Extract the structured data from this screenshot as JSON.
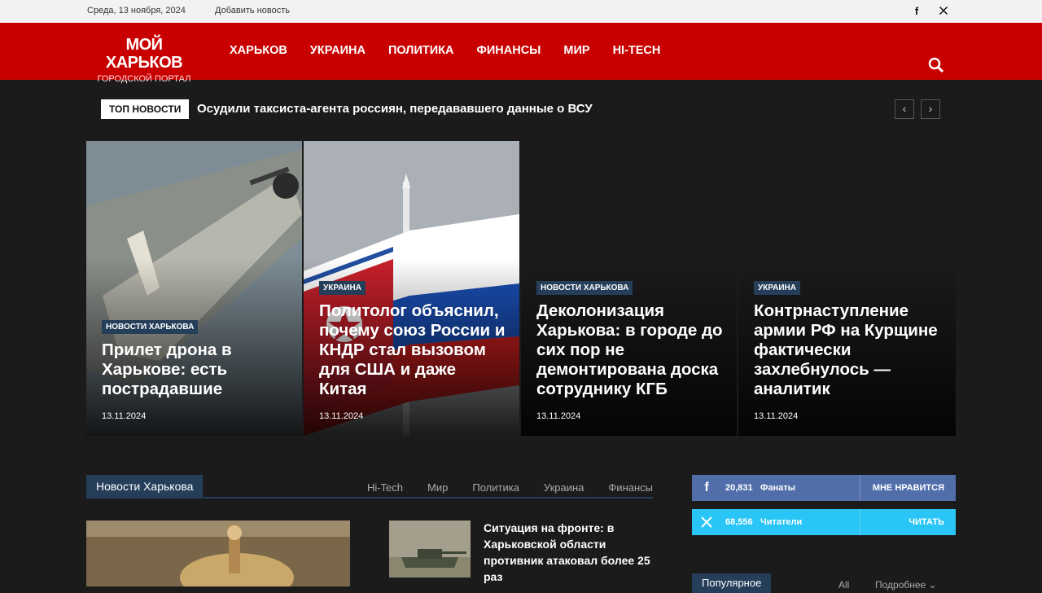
{
  "topbar": {
    "date": "Среда, 13 ноября, 2024",
    "add_news": "Добавить новость",
    "social_icons": [
      "facebook-icon",
      "x-icon"
    ]
  },
  "header": {
    "logo_line1": "МОЙ ХАРЬКОВ",
    "logo_line2": "ГОРОДСКОЙ ПОРТАЛ",
    "nav": [
      "ХАРЬКОВ",
      "УКРАИНА",
      "ПОЛИТИКА",
      "ФИНАНСЫ",
      "МИР",
      "HI-TECH"
    ],
    "accent_color": "#c90000"
  },
  "ticker": {
    "tag": "ТОП НОВОСТИ",
    "headline": "Осудили таксиста-агента россиян, передававшего данные о ВСУ"
  },
  "featured": [
    {
      "category": "НОВОСТИ ХАРЬКОВА",
      "title": "Прилет дрона в Харькове: есть пострадавшие",
      "date": "13.11.2024"
    },
    {
      "category": "УКРАИНА",
      "title": "Политолог объяснил, почему союз России и КНДР стал вызовом для США и даже Китая",
      "date": "13.11.2024"
    },
    {
      "category": "НОВОСТИ ХАРЬКОВА",
      "title": "Деколонизация Харькова: в городе до сих пор не демонтирована доска сотруднику КГБ",
      "date": "13.11.2024"
    },
    {
      "category": "УКРАИНА",
      "title": "Контрнаступление армии РФ на Курщине фактически захлебнулось — аналитик",
      "date": "13.11.2024"
    }
  ],
  "section": {
    "title": "Новости Харькова",
    "tabs": [
      "Hi-Tech",
      "Мир",
      "Политика",
      "Украина",
      "Финансы"
    ],
    "side_article_title": "Ситуация на фронте: в Харьковской области противник атаковал более 25 раз"
  },
  "widgets": {
    "facebook": {
      "count": "20,831",
      "label": "Фанаты",
      "action": "МНЕ НРАВИТСЯ",
      "color": "#516eab"
    },
    "x": {
      "count": "68,556",
      "label": "Читатели",
      "action": "ЧИТАТЬ",
      "color": "#29c5f6"
    }
  },
  "popular": {
    "title": "Популярное",
    "all": "All",
    "more": "Подробнее"
  },
  "colors": {
    "category_bg": "#253e5a",
    "page_bg": "#1b1b1b"
  }
}
